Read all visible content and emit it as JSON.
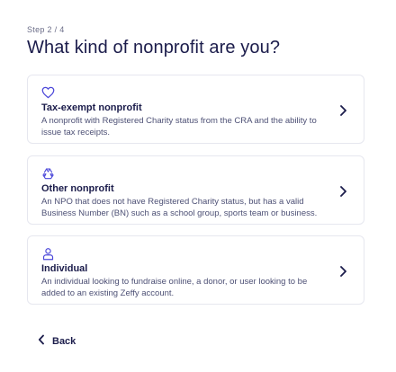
{
  "step_label": "Step 2 / 4",
  "title": "What kind of nonprofit are you?",
  "options": [
    {
      "icon": "heart-icon",
      "title": "Tax-exempt nonprofit",
      "description": "A nonprofit with Registered Charity status from the CRA and the ability to issue tax receipts."
    },
    {
      "icon": "recycle-icon",
      "title": "Other nonprofit",
      "description": "An NPO that does not have Registered Charity status, but has a valid Business Number (BN) such as a school group, sports team or business."
    },
    {
      "icon": "person-icon",
      "title": "Individual",
      "description": "An individual looking to fundraise online, a donor, or user looking to be added to an existing Zeffy account."
    }
  ],
  "back_label": "Back",
  "colors": {
    "accent": "#4b47d9",
    "text": "#1b1c4b",
    "muted": "#4d5075",
    "border": "#e6e7ef"
  }
}
